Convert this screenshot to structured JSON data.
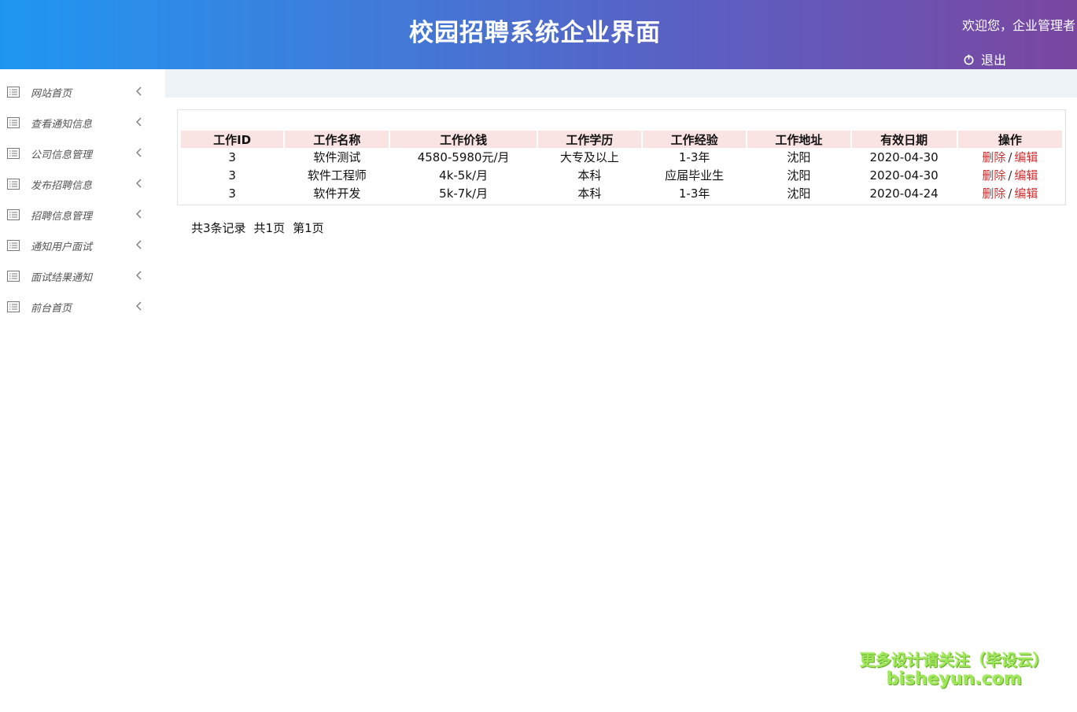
{
  "header": {
    "title": "校园招聘系统企业界面",
    "welcome": "欢迎您，企业管理者",
    "logout": "退出"
  },
  "sidebar": {
    "items": [
      {
        "label": "网站首页",
        "icon": "list-icon"
      },
      {
        "label": "查看通知信息",
        "icon": "list-icon"
      },
      {
        "label": "公司信息管理",
        "icon": "list-icon"
      },
      {
        "label": "发布招聘信息",
        "icon": "list-icon"
      },
      {
        "label": "招聘信息管理",
        "icon": "list-icon"
      },
      {
        "label": "通知用户面试",
        "icon": "list-icon"
      },
      {
        "label": "面试结果通知",
        "icon": "list-icon"
      },
      {
        "label": "前台首页",
        "icon": "list-icon"
      }
    ]
  },
  "table": {
    "headers": [
      "工作ID",
      "工作名称",
      "工作价钱",
      "工作学历",
      "工作经验",
      "工作地址",
      "有效日期",
      "操作"
    ],
    "rows": [
      [
        "3",
        "软件测试",
        "4580-5980元/月",
        "大专及以上",
        "1-3年",
        "沈阳",
        "2020-04-30"
      ],
      [
        "3",
        "软件工程师",
        "4k-5k/月",
        "本科",
        "应届毕业生",
        "沈阳",
        "2020-04-30"
      ],
      [
        "3",
        "软件开发",
        "5k-7k/月",
        "本科",
        "1-3年",
        "沈阳",
        "2020-04-24"
      ]
    ],
    "delete_label": "删除",
    "separator": "/",
    "edit_label": "编辑"
  },
  "pager": {
    "total_records": "共3条记录",
    "total_pages": "共1页",
    "current_page": "第1页"
  },
  "watermark": {
    "line1": "更多设计请关注（毕设云）",
    "line2": "bisheyun.com"
  },
  "colors": {
    "header_gradient_start": "#1f97f1",
    "header_gradient_end": "#7a47a0",
    "table_header_bg": "#fae3e3",
    "link_red": "#d03030",
    "watermark_green": "#9ee65a"
  }
}
